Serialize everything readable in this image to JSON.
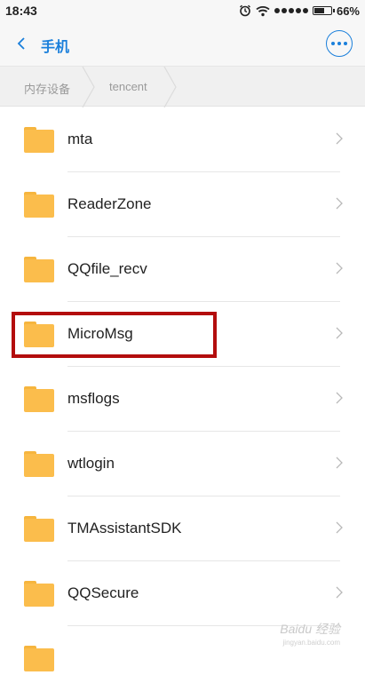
{
  "status_bar": {
    "time": "18:43",
    "battery": "66%",
    "battery_level": 0.66,
    "icons": [
      "alarm-icon",
      "wifi-icon",
      "signal-icon",
      "battery-icon"
    ]
  },
  "header": {
    "back_icon": "chevron-left-icon",
    "title": "手机",
    "more_icon": "more-dots-icon",
    "accent_color": "#1a7fdb"
  },
  "breadcrumb": {
    "items": [
      "内存设备",
      "tencent"
    ]
  },
  "files": [
    {
      "name": "mta",
      "icon": "folder-icon"
    },
    {
      "name": "ReaderZone",
      "icon": "folder-icon"
    },
    {
      "name": "QQfile_recv",
      "icon": "folder-icon"
    },
    {
      "name": "MicroMsg",
      "icon": "folder-icon",
      "highlighted": true
    },
    {
      "name": "msflogs",
      "icon": "folder-icon"
    },
    {
      "name": "wtlogin",
      "icon": "folder-icon"
    },
    {
      "name": "TMAssistantSDK",
      "icon": "folder-icon"
    },
    {
      "name": "QQSecure",
      "icon": "folder-icon"
    }
  ],
  "colors": {
    "folder": "#fbbd4c",
    "highlight_border": "#b30d0d"
  },
  "watermark": {
    "text": "Baidu 经验",
    "subtext": "jingyan.baidu.com"
  }
}
